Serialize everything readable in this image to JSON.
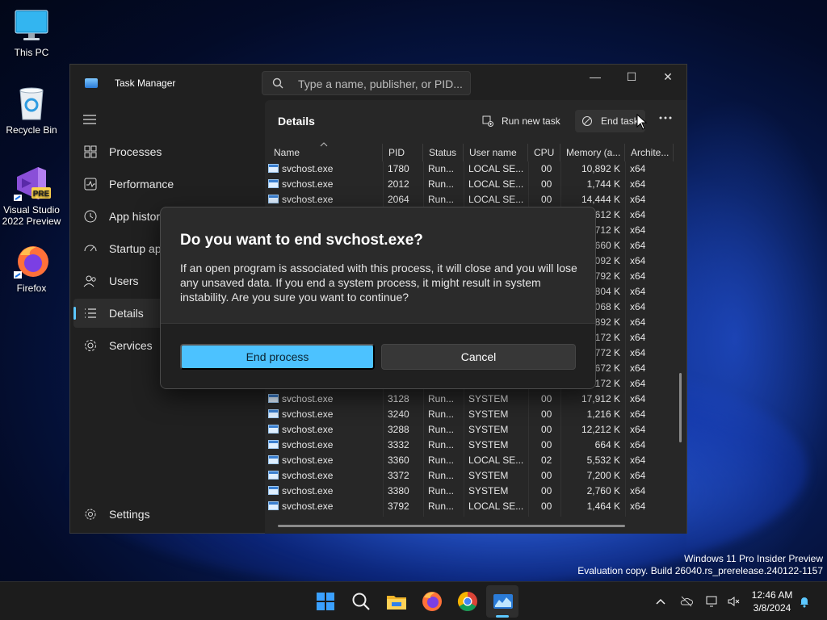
{
  "desktop": {
    "icons": [
      {
        "label": "This PC"
      },
      {
        "label": "Recycle Bin"
      },
      {
        "label": "Visual Studio 2022 Preview",
        "badge": "PRE"
      },
      {
        "label": "Firefox"
      }
    ]
  },
  "window": {
    "title": "Task Manager",
    "search_placeholder": "Type a name, publisher, or PID...",
    "controls": {
      "minimize": "—",
      "maximize": "☐",
      "close": "✕"
    }
  },
  "sidebar": {
    "items": [
      {
        "label": "Processes",
        "icon": "processes-icon"
      },
      {
        "label": "Performance",
        "icon": "performance-icon"
      },
      {
        "label": "App history",
        "icon": "app-history-icon"
      },
      {
        "label": "Startup apps",
        "icon": "startup-apps-icon"
      },
      {
        "label": "Users",
        "icon": "users-icon"
      },
      {
        "label": "Details",
        "icon": "details-icon",
        "active": true
      },
      {
        "label": "Services",
        "icon": "services-icon"
      }
    ],
    "settings_label": "Settings"
  },
  "details": {
    "title": "Details",
    "run_new_task": "Run new task",
    "end_task": "End task",
    "more": "...",
    "columns": [
      "Name",
      "PID",
      "Status",
      "User name",
      "CPU",
      "Memory (a...",
      "Archite..."
    ],
    "rows": [
      [
        "svchost.exe",
        "1780",
        "Run...",
        "LOCAL SE...",
        "00",
        "10,892 K",
        "x64"
      ],
      [
        "svchost.exe",
        "2012",
        "Run...",
        "LOCAL SE...",
        "00",
        "1,744 K",
        "x64"
      ],
      [
        "svchost.exe",
        "2064",
        "Run...",
        "LOCAL SE...",
        "00",
        "14,444 K",
        "x64"
      ],
      [
        "",
        "",
        "",
        "",
        "",
        "612 K",
        "x64"
      ],
      [
        "",
        "",
        "",
        "",
        "",
        "712 K",
        "x64"
      ],
      [
        "",
        "",
        "",
        "",
        "",
        "660 K",
        "x64"
      ],
      [
        "",
        "",
        "",
        "",
        "",
        "092 K",
        "x64"
      ],
      [
        "",
        "",
        "",
        "",
        "",
        "792 K",
        "x64"
      ],
      [
        "",
        "",
        "",
        "",
        "",
        "804 K",
        "x64"
      ],
      [
        "",
        "",
        "",
        "",
        "",
        "068 K",
        "x64"
      ],
      [
        "",
        "",
        "",
        "",
        "",
        "892 K",
        "x64"
      ],
      [
        "",
        "",
        "",
        "",
        "",
        "172 K",
        "x64"
      ],
      [
        "",
        "",
        "",
        "",
        "",
        "772 K",
        "x64"
      ],
      [
        "",
        "",
        "",
        "",
        "",
        "672 K",
        "x64"
      ],
      [
        "",
        "",
        "",
        "",
        "",
        "172 K",
        "x64"
      ],
      [
        "svchost.exe",
        "3128",
        "Run...",
        "SYSTEM",
        "00",
        "17,912 K",
        "x64"
      ],
      [
        "svchost.exe",
        "3240",
        "Run...",
        "SYSTEM",
        "00",
        "1,216 K",
        "x64"
      ],
      [
        "svchost.exe",
        "3288",
        "Run...",
        "SYSTEM",
        "00",
        "12,212 K",
        "x64"
      ],
      [
        "svchost.exe",
        "3332",
        "Run...",
        "SYSTEM",
        "00",
        "664 K",
        "x64"
      ],
      [
        "svchost.exe",
        "3360",
        "Run...",
        "LOCAL SE...",
        "02",
        "5,532 K",
        "x64"
      ],
      [
        "svchost.exe",
        "3372",
        "Run...",
        "SYSTEM",
        "00",
        "7,200 K",
        "x64"
      ],
      [
        "svchost.exe",
        "3380",
        "Run...",
        "SYSTEM",
        "00",
        "2,760 K",
        "x64"
      ],
      [
        "svchost.exe",
        "3792",
        "Run...",
        "LOCAL SE...",
        "00",
        "1,464 K",
        "x64"
      ]
    ]
  },
  "dialog": {
    "title": "Do you want to end svchost.exe?",
    "message": "If an open program is associated with this process, it will close and you will lose any unsaved data. If you end a system process, it might result in system instability. Are you sure you want to continue?",
    "primary": "End process",
    "secondary": "Cancel"
  },
  "watermark": {
    "line1": "Windows 11 Pro Insider Preview",
    "line2": "Evaluation copy. Build 26040.rs_prerelease.240122-1157"
  },
  "taskbar": {
    "time": "12:46 AM",
    "date": "3/8/2024",
    "apps": [
      "start-icon",
      "search-icon",
      "file-explorer-icon",
      "firefox-icon",
      "chrome-icon",
      "task-manager-icon"
    ]
  },
  "colors": {
    "accent": "#4cc2ff",
    "window_bg": "#202020",
    "content_bg": "#272727"
  }
}
